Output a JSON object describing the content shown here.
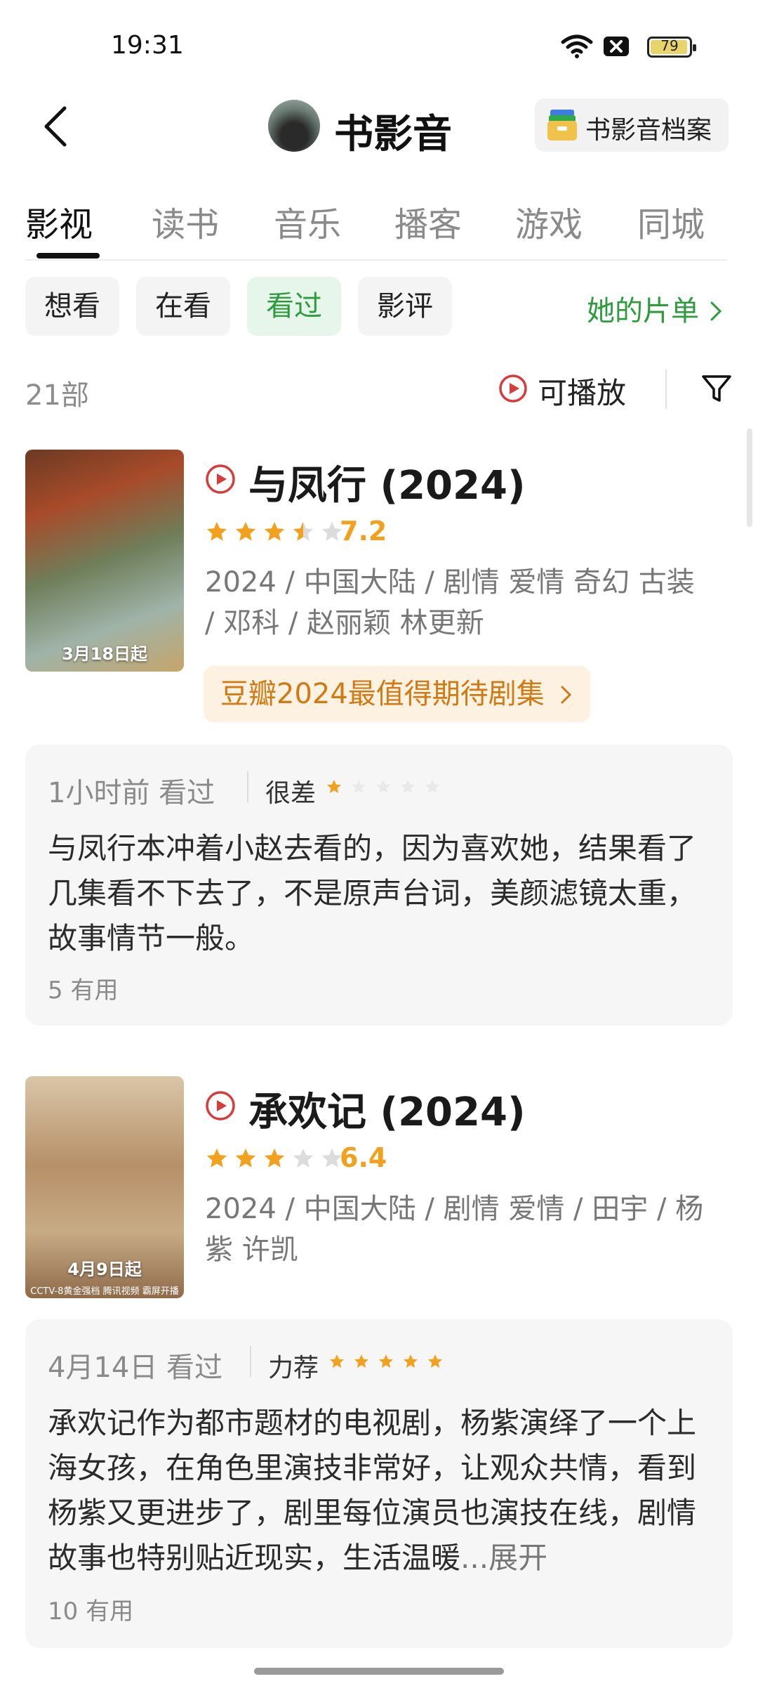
{
  "status_bar": {
    "time": "19:31",
    "battery": "79"
  },
  "header": {
    "title": "书影音",
    "archive_label": "书影音档案"
  },
  "tabs": [
    {
      "label": "影视",
      "active": true
    },
    {
      "label": "读书"
    },
    {
      "label": "音乐"
    },
    {
      "label": "播客"
    },
    {
      "label": "游戏"
    },
    {
      "label": "同城"
    }
  ],
  "filters": [
    {
      "label": "想看"
    },
    {
      "label": "在看"
    },
    {
      "label": "看过",
      "selected": true
    },
    {
      "label": "影评"
    }
  ],
  "her_list": "她的片单",
  "count": "21部",
  "playable": "可播放",
  "colors": {
    "accent_green": "#2e9c3e",
    "star_orange": "#f2a11f",
    "play_red": "#d83b3b"
  },
  "movies": [
    {
      "title": "与凤行 (2024)",
      "rating": "7.2",
      "stars": 3.5,
      "meta": "2024 / 中国大陆 / 剧情 爱情 奇幻 古装 / 邓科 / 赵丽颖 林更新",
      "poster_text": "3月18日起",
      "badge": "豆瓣2024最值得期待剧集",
      "review": {
        "time": "1小时前 看过",
        "level": "很差",
        "stars": 1,
        "text": "与凤行本冲着小赵去看的，因为喜欢她，结果看了几集看不下去了，不是原声台词，美颜滤镜太重，故事情节一般。",
        "useful": "5 有用"
      }
    },
    {
      "title": "承欢记 (2024)",
      "rating": "6.4",
      "stars": 3,
      "meta": "2024 / 中国大陆 / 剧情 爱情 / 田宇 / 杨紫 许凯",
      "poster_text": "4月9日起",
      "poster_sub": "CCTV-8黄金强档 腾讯视频 霸屏开播",
      "review": {
        "time": "4月14日 看过",
        "level": "力荐",
        "stars": 5,
        "text": "承欢记作为都市题材的电视剧，杨紫演绎了一个上海女孩，在角色里演技非常好，让观众共情，看到杨紫又更进步了，剧里每位演员也演技在线，剧情故事也特别贴近现实，生活温暖",
        "expand": "...展开",
        "useful": "10 有用"
      }
    }
  ]
}
